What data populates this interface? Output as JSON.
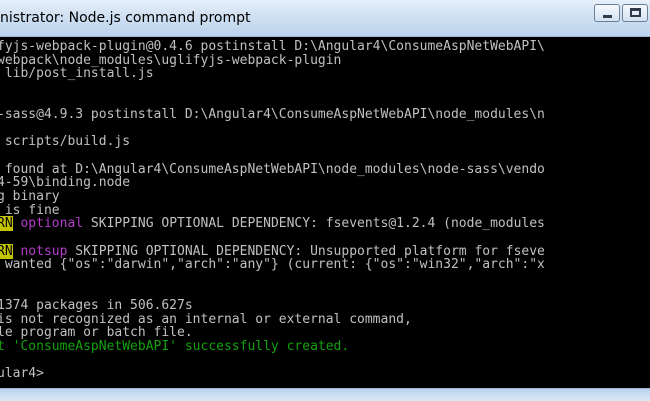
{
  "window": {
    "title": "nistrator: Node.js command prompt"
  },
  "console": {
    "lines": [
      {
        "segments": [
          {
            "text": "fyjs-webpack-plugin@0.4.6 postinstall D:\\Angular4\\ConsumeAspNetWebAPI\\",
            "style": "normal"
          }
        ]
      },
      {
        "segments": [
          {
            "text": "webpack\\node_modules\\uglifyjs-webpack-plugin",
            "style": "normal"
          }
        ]
      },
      {
        "segments": [
          {
            "text": " lib/post_install.js",
            "style": "normal"
          }
        ]
      },
      {
        "segments": [
          {
            "text": "",
            "style": "normal"
          }
        ]
      },
      {
        "segments": [
          {
            "text": "",
            "style": "normal"
          }
        ]
      },
      {
        "segments": [
          {
            "text": "-sass@4.9.3 postinstall D:\\Angular4\\ConsumeAspNetWebAPI\\node_modules\\n",
            "style": "normal"
          }
        ]
      },
      {
        "segments": [
          {
            "text": "",
            "style": "normal"
          }
        ]
      },
      {
        "segments": [
          {
            "text": " scripts/build.js",
            "style": "normal"
          }
        ]
      },
      {
        "segments": [
          {
            "text": "",
            "style": "normal"
          }
        ]
      },
      {
        "segments": [
          {
            "text": " found at D:\\Angular4\\ConsumeAspNetWebAPI\\node_modules\\node-sass\\vendo",
            "style": "normal"
          }
        ]
      },
      {
        "segments": [
          {
            "text": "4-59\\binding.node",
            "style": "normal"
          }
        ]
      },
      {
        "segments": [
          {
            "text": "g binary",
            "style": "normal"
          }
        ]
      },
      {
        "segments": [
          {
            "text": " is fine",
            "style": "normal"
          }
        ]
      },
      {
        "segments": [
          {
            "text": "RN",
            "style": "warn"
          },
          {
            "text": " ",
            "style": "normal"
          },
          {
            "text": "optional",
            "style": "magenta"
          },
          {
            "text": " SKIPPING OPTIONAL DEPENDENCY: fsevents@1.2.4 (node_modules",
            "style": "normal"
          }
        ]
      },
      {
        "segments": [
          {
            "text": "",
            "style": "normal"
          }
        ]
      },
      {
        "segments": [
          {
            "text": "RN",
            "style": "warn"
          },
          {
            "text": " ",
            "style": "normal"
          },
          {
            "text": "notsup",
            "style": "magenta"
          },
          {
            "text": " SKIPPING OPTIONAL DEPENDENCY: Unsupported platform for fseve",
            "style": "normal"
          }
        ]
      },
      {
        "segments": [
          {
            "text": " wanted {\"os\":\"darwin\",\"arch\":\"any\"} (current: {\"os\":\"win32\",\"arch\":\"x",
            "style": "normal"
          }
        ]
      },
      {
        "segments": [
          {
            "text": "",
            "style": "normal"
          }
        ]
      },
      {
        "segments": [
          {
            "text": "",
            "style": "normal"
          }
        ]
      },
      {
        "segments": [
          {
            "text": "1374 packages in 506.627s",
            "style": "normal"
          }
        ]
      },
      {
        "segments": [
          {
            "text": "is not recognized as an internal or external command,",
            "style": "normal"
          }
        ]
      },
      {
        "segments": [
          {
            "text": "le program or batch file.",
            "style": "normal"
          }
        ]
      },
      {
        "segments": [
          {
            "text": "t 'ConsumeAspNetWebAPI' successfully created.",
            "style": "green"
          }
        ]
      },
      {
        "segments": [
          {
            "text": "",
            "style": "normal"
          }
        ]
      },
      {
        "segments": [
          {
            "text": "ular4>",
            "style": "normal"
          }
        ]
      }
    ]
  }
}
